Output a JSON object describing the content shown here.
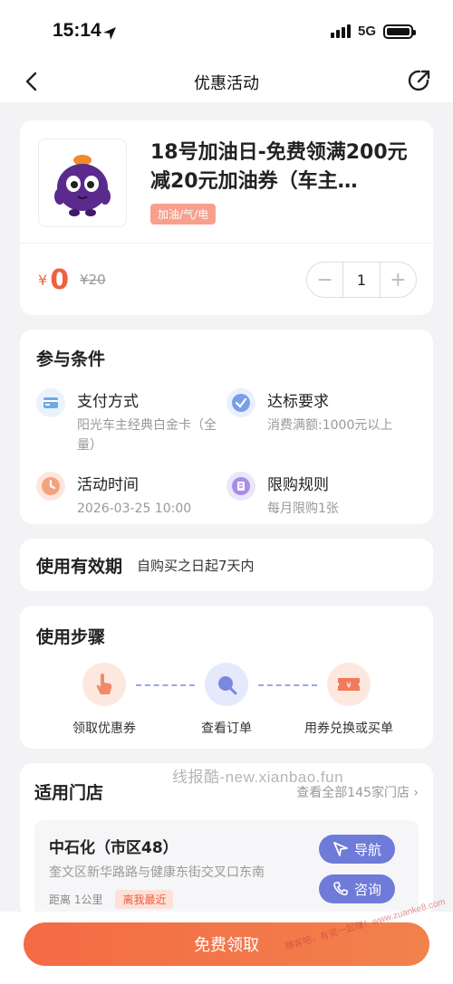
{
  "status_bar": {
    "time": "15:14",
    "network": "5G"
  },
  "nav": {
    "title": "优惠活动"
  },
  "product": {
    "title": "18号加油日-免费领满200元减20元加油券（车主…",
    "tag": "加油/气/电",
    "price_currency": "¥",
    "price": "0",
    "original_price": "¥20",
    "quantity": "1",
    "minus": "−",
    "plus": "+"
  },
  "conditions": {
    "title": "参与条件",
    "items": [
      {
        "label": "支付方式",
        "value": "阳光车主经典白金卡（全量）",
        "icon": "card-icon",
        "color": "#eaf3fc"
      },
      {
        "label": "达标要求",
        "value": "消费满额:1000元以上",
        "icon": "check-badge-icon",
        "color": "#e8f1fd"
      },
      {
        "label": "活动时间",
        "value": "2026-03-25 10:00",
        "icon": "clock-icon",
        "color": "#fde7dc"
      },
      {
        "label": "限购规则",
        "value": "每月限购1张",
        "icon": "document-icon",
        "color": "#ece6fb"
      }
    ]
  },
  "validity": {
    "title": "使用有效期",
    "text": "自购买之日起7天内"
  },
  "steps": {
    "title": "使用步骤",
    "items": [
      {
        "label": "领取优惠券",
        "icon": "tap-hand-icon"
      },
      {
        "label": "查看订单",
        "icon": "search-icon"
      },
      {
        "label": "用券兑换或买单",
        "icon": "ticket-icon"
      }
    ]
  },
  "stores": {
    "title": "适用门店",
    "view_all": "查看全部145家门店 ›",
    "item": {
      "name": "中石化（市区48）",
      "address": "奎文区新华路路与健康东街交叉口东南",
      "distance": "距离 1公里",
      "badge": "离我最近",
      "nav_label": "导航",
      "consult_label": "咨询"
    }
  },
  "watermark": "线报酷-new.xianbao.fun",
  "corner_watermark": "赚客吧，有奖一起赚！www.zuanke8.com",
  "bottom": {
    "claim_label": "免费领取"
  },
  "colors": {
    "accent": "#f46a45",
    "store_button": "#6f7bd9"
  }
}
